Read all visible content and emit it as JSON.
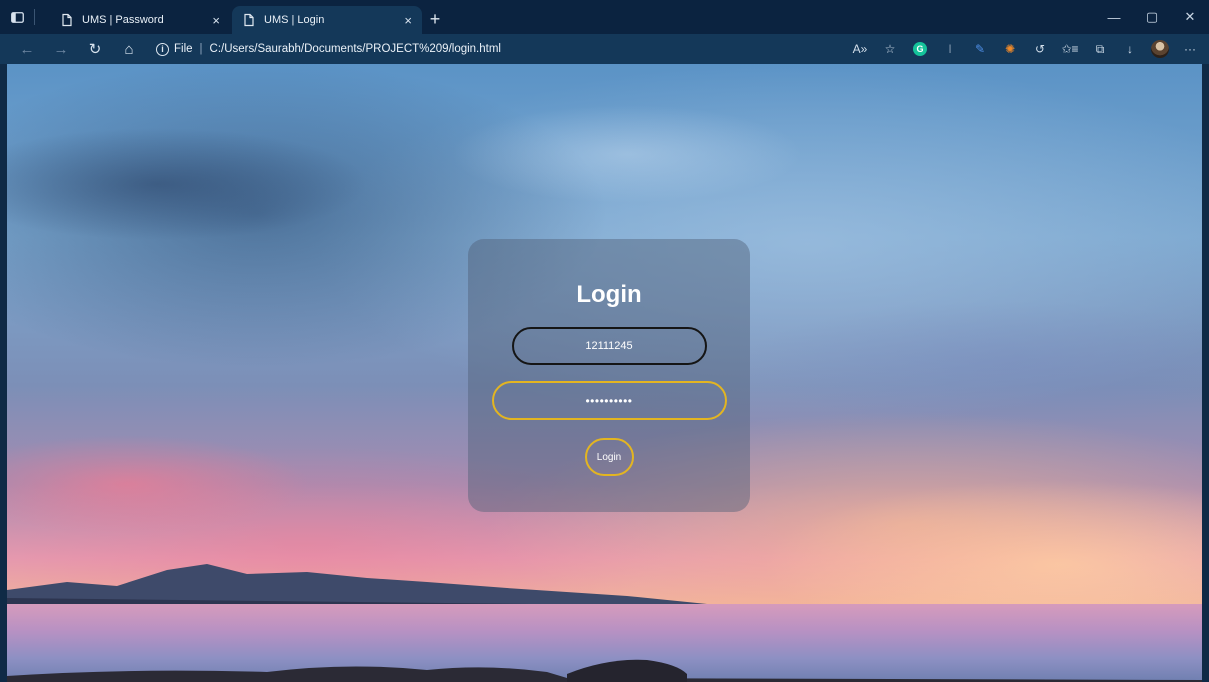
{
  "browser": {
    "tabs": [
      {
        "title": "UMS | Password",
        "active": false
      },
      {
        "title": "UMS | Login",
        "active": true
      }
    ],
    "address": {
      "scheme_label": "File",
      "url": "C:/Users/Saurabh/Documents/PROJECT%209/login.html"
    },
    "glyphs": {
      "close": "×",
      "new_tab": "+",
      "minimize": "—",
      "restore": "▢",
      "window_close": "✕",
      "back": "←",
      "forward": "→",
      "refresh": "↻",
      "home": "⌂",
      "info": "i",
      "read_aloud": "A»",
      "favorite": "☆",
      "grammarly": "G",
      "text_cursor": "I",
      "pen": "✎",
      "extension": "✺",
      "copilot": "↺",
      "favorites": "✩≡",
      "collections": "⧉",
      "downloads": "↓",
      "more": "···"
    }
  },
  "login": {
    "title": "Login",
    "username_value": "12111245",
    "password_value": "••••••••••",
    "button_label": "Login"
  },
  "colors": {
    "accent": "#e3b521",
    "username_border": "#151515"
  }
}
